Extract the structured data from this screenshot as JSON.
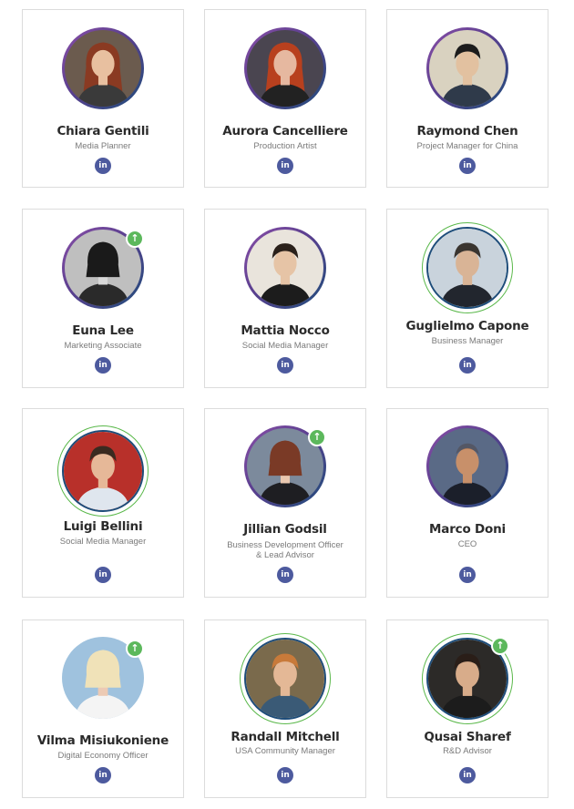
{
  "team": [
    {
      "name": "Chiara Gentili",
      "role": "Media Planner",
      "linkedin_label": "in",
      "ring": "purple",
      "badge": false
    },
    {
      "name": "Aurora Cancelliere",
      "role": "Production Artist",
      "linkedin_label": "in",
      "ring": "purple",
      "badge": false
    },
    {
      "name": "Raymond Chen",
      "role": "Project Manager for China",
      "linkedin_label": "in",
      "ring": "purple",
      "badge": false
    },
    {
      "name": "Euna Lee",
      "role": "Marketing Associate",
      "linkedin_label": "in",
      "ring": "purple",
      "badge": true
    },
    {
      "name": "Mattia Nocco",
      "role": "Social Media Manager",
      "linkedin_label": "in",
      "ring": "purple",
      "badge": false
    },
    {
      "name": "Guglielmo Capone",
      "role": "Business Manager",
      "linkedin_label": "in",
      "ring": "green",
      "badge": false
    },
    {
      "name": "Luigi Bellini",
      "role": "Social Media Manager",
      "linkedin_label": "in",
      "ring": "green",
      "badge": false
    },
    {
      "name": "Jillian Godsil",
      "role": "Business Development Officer & Lead Advisor",
      "linkedin_label": "in",
      "ring": "purple",
      "badge": true
    },
    {
      "name": "Marco Doni",
      "role": "CEO",
      "linkedin_label": "in",
      "ring": "purple",
      "badge": false
    },
    {
      "name": "Vilma Misiukoniene",
      "role": "Digital Economy Officer",
      "linkedin_label": "in",
      "ring": "none",
      "badge": true
    },
    {
      "name": "Randall Mitchell",
      "role": "USA Community Manager",
      "linkedin_label": "in",
      "ring": "green",
      "badge": false
    },
    {
      "name": "Qusai Sharef",
      "role": "R&D Advisor",
      "linkedin_label": "in",
      "ring": "green",
      "badge": true
    }
  ],
  "badge_icon": "arrow-up-icon",
  "badge_glyph": "↑",
  "colors": {
    "linkedin": "#4d5a9e",
    "badge": "#5cb85c",
    "ring_green": "#5ab84a",
    "ring_purple": "#8a4fa8",
    "ring_blue": "#1e4d7a",
    "card_border": "#dcdcdc",
    "name_text": "#2b2b2b",
    "role_text": "#7a7a7a"
  }
}
